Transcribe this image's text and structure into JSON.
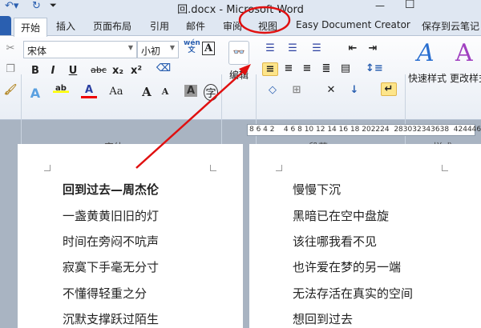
{
  "window": {
    "title": "回.docx  -  Microsoft Word",
    "minimize": "—",
    "maximize": "☐"
  },
  "tabs": [
    {
      "label": "开始"
    },
    {
      "label": "插入"
    },
    {
      "label": "页面布局"
    },
    {
      "label": "引用"
    },
    {
      "label": "邮件"
    },
    {
      "label": "审阅"
    },
    {
      "label": "视图"
    },
    {
      "label": "Easy Document Creator"
    },
    {
      "label": "保存到云笔记"
    }
  ],
  "font": {
    "name": "宋体",
    "size": "小初",
    "group_label": "字体",
    "bold": "B",
    "italic": "I",
    "underline": "U",
    "strike": "abc",
    "sub": "x₂",
    "sup": "x²",
    "color": "A",
    "case": "Aa",
    "grow": "A",
    "shrink": "A",
    "wen": "wén\n文",
    "charborder": "A",
    "charshade": "A",
    "enclose": "字"
  },
  "editing": {
    "label": "编辑"
  },
  "paragraph": {
    "group_label": "段落"
  },
  "styles": {
    "group_label": "样式",
    "quick": "快速样式",
    "change": "更改样式"
  },
  "ruler": {
    "text": "8 6 4 2    4 6 8 10 12 14 16 18 202224  283032343638  424446"
  },
  "colors": {
    "annotation": "#e01010",
    "accent": "#2a5fb0"
  },
  "document": {
    "left": [
      "回到过去—周杰伦",
      "一盏黄黄旧旧的灯",
      "时间在旁闷不吭声",
      "寂寞下手毫无分寸",
      "不懂得轻重之分",
      "沉默支撑跃过陌生"
    ],
    "right": [
      "慢慢下沉",
      "黑暗已在空中盘旋",
      "该往哪我看不见",
      "也许爱在梦的另一端",
      "无法存活在真实的空间",
      "想回到过去"
    ]
  }
}
